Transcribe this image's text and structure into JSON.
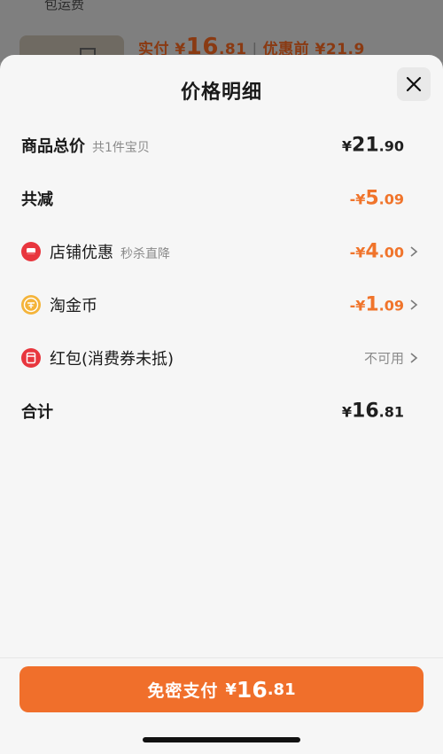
{
  "background": {
    "shipping_text": "包运费",
    "price_prefix": "实付 ¥",
    "price_int": "16",
    "price_dec": ".81",
    "separator": " | ",
    "original_text": "优惠前 ¥21.9"
  },
  "sheet": {
    "title": "价格明细",
    "close_icon": "close-icon"
  },
  "rows": {
    "total": {
      "label": "商品总价",
      "sub": "共1件宝贝",
      "yen": "¥",
      "int": "21",
      "dec": ".90"
    },
    "reduction": {
      "label": "共减",
      "sign": "-¥",
      "int": "5",
      "dec": ".09"
    },
    "store": {
      "label": "店铺优惠",
      "sub": "秒杀直降",
      "icon": "store-discount-icon",
      "sign": "-¥",
      "int": "4",
      "dec": ".00"
    },
    "coins": {
      "label": "淘金币",
      "icon": "gold-coin-icon",
      "sign": "-¥",
      "int": "1",
      "dec": ".09"
    },
    "redpacket": {
      "label": "红包(消费券未抵)",
      "icon": "red-packet-icon",
      "status": "不可用"
    },
    "sum": {
      "label": "合计",
      "yen": "¥",
      "int": "16",
      "dec": ".81"
    }
  },
  "footer": {
    "pay_label": "免密支付",
    "yen": "¥",
    "int": "16",
    "dec": ".81"
  },
  "colors": {
    "accent": "#f06f2b",
    "sheet_bg": "#f6f6f6",
    "text": "#1a1a1a",
    "muted": "#8a8a8a"
  }
}
